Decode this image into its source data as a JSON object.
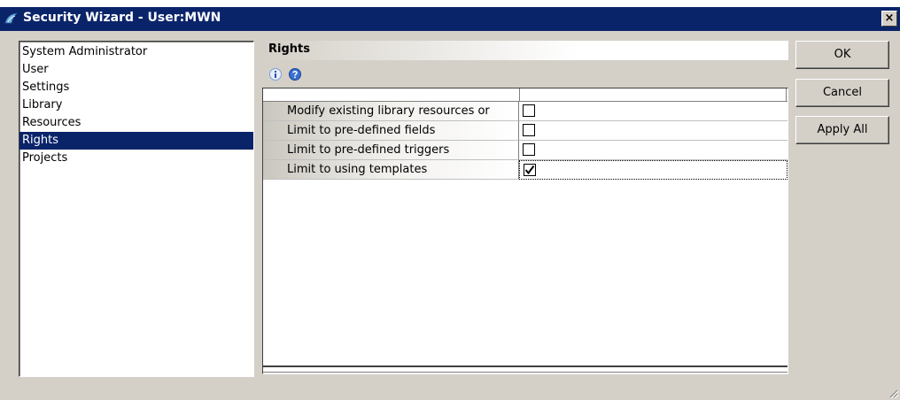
{
  "window": {
    "title": "Security Wizard - User:MWN",
    "close_label": "×"
  },
  "nav": {
    "items": [
      {
        "label": "System Administrator",
        "selected": false
      },
      {
        "label": "User",
        "selected": false
      },
      {
        "label": "Settings",
        "selected": false
      },
      {
        "label": "Library",
        "selected": false
      },
      {
        "label": "Resources",
        "selected": false
      },
      {
        "label": "Rights",
        "selected": true
      },
      {
        "label": "Projects",
        "selected": false
      }
    ]
  },
  "panel": {
    "title": "Rights",
    "icons": [
      "info-icon",
      "help-icon"
    ]
  },
  "grid": {
    "rows": [
      {
        "label": "Modify existing library resources or",
        "checked": false
      },
      {
        "label": "Limit to pre-defined fields",
        "checked": false
      },
      {
        "label": "Limit to pre-defined triggers",
        "checked": false
      },
      {
        "label": "Limit to using templates",
        "checked": true
      }
    ]
  },
  "buttons": {
    "ok": "OK",
    "cancel": "Cancel",
    "apply_all": "Apply All"
  },
  "colors": {
    "title_bar": "#0a246a",
    "selection": "#0a246a",
    "dialog_face": "#d4d0c8"
  }
}
